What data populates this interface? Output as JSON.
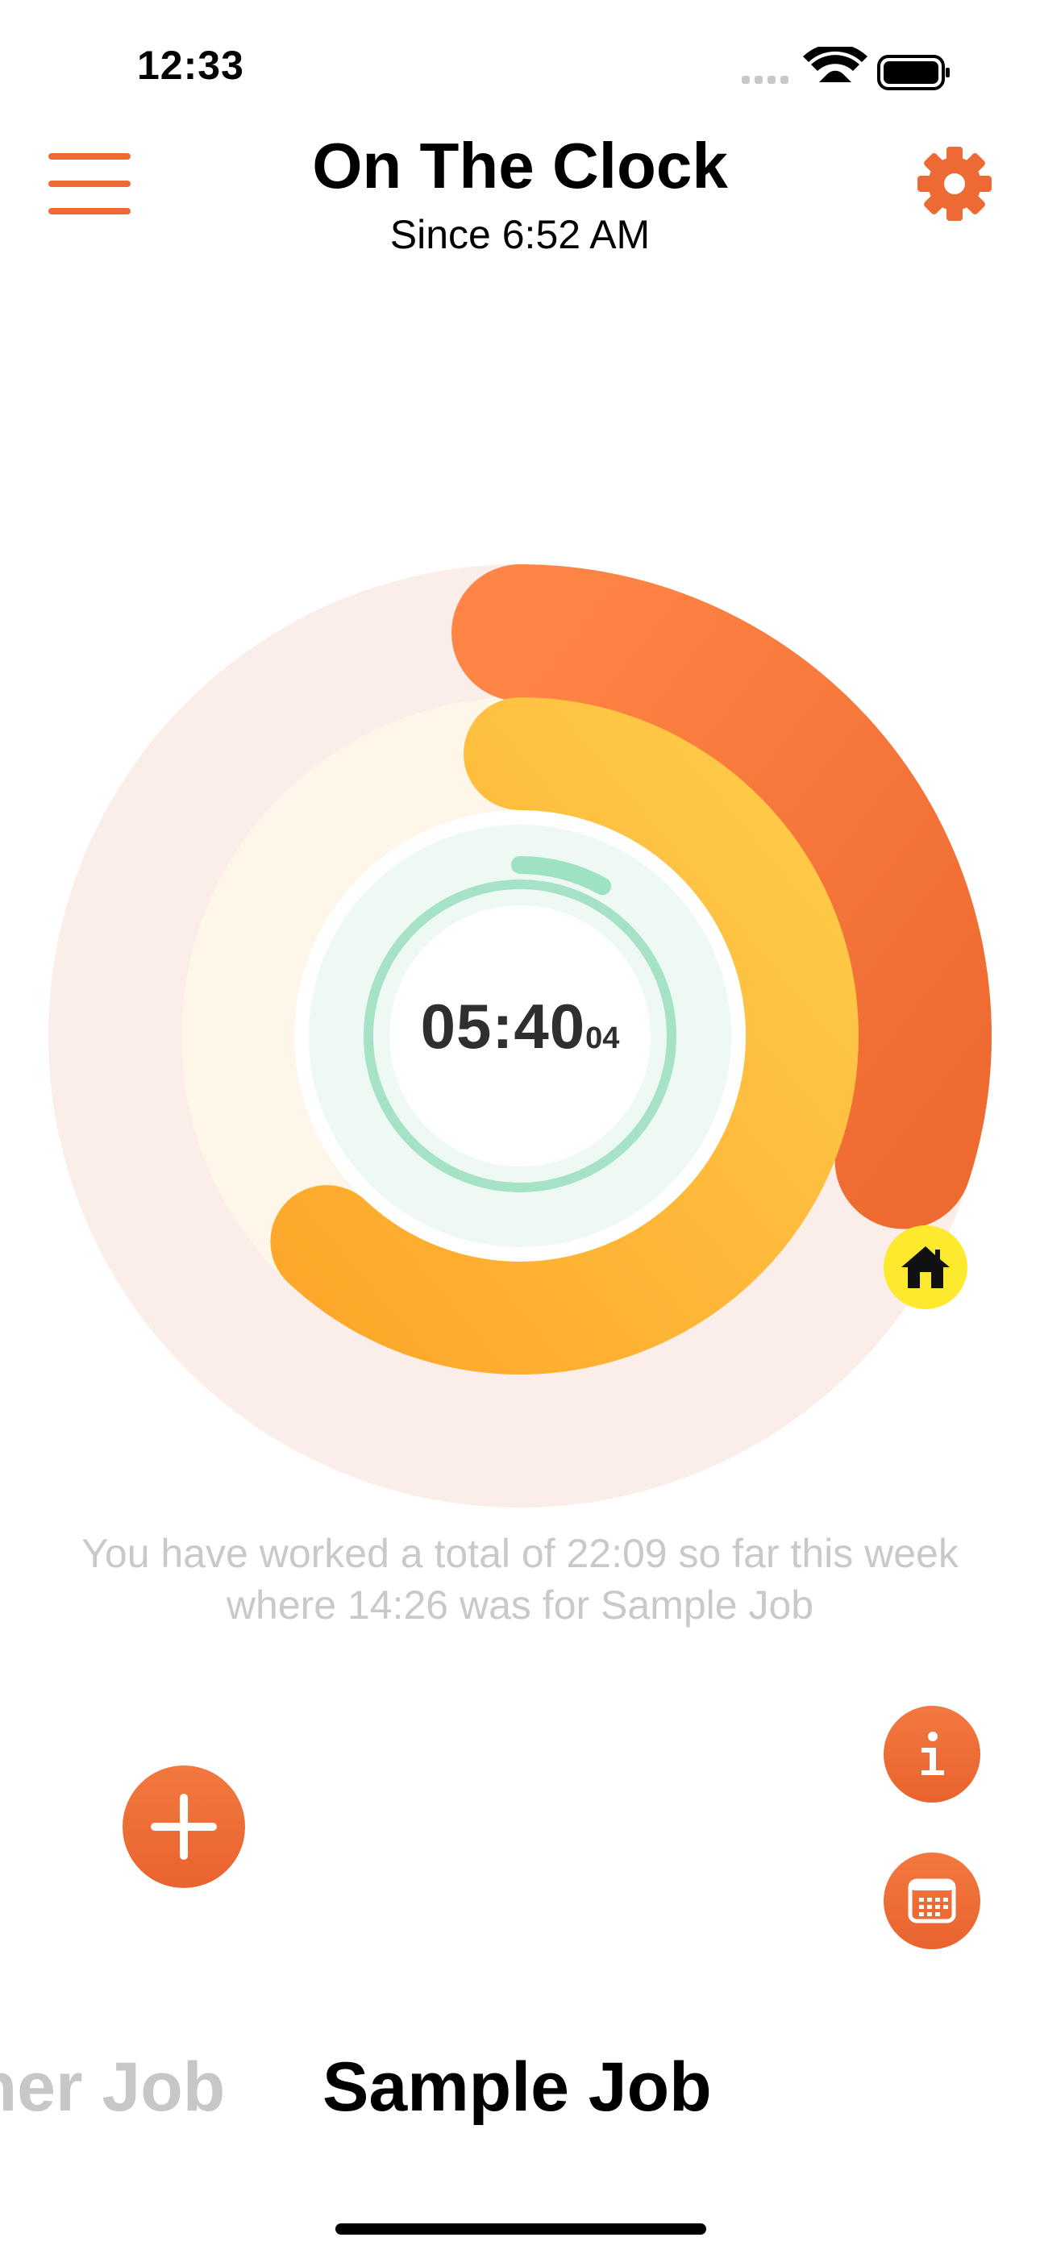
{
  "status_bar": {
    "time": "12:33"
  },
  "header": {
    "title": "On The Clock",
    "subtitle": "Since 6:52 AM"
  },
  "timer": {
    "main": "05:40",
    "seconds": "04"
  },
  "progress": {
    "week_ring_fraction": 0.3,
    "job_ring_fraction": 0.62,
    "day_ring_fraction": 0.08
  },
  "colors": {
    "accent": "#ED6A35",
    "week_ring": "#F47A3C",
    "week_track": "#FBEDE8",
    "job_ring": "#FDBA3A",
    "job_track": "#FFF6EA",
    "day_ring": "#A6E3C6",
    "home_badge": "#FDE92E"
  },
  "summary": {
    "line1": "You have worked a total of 22:09 so far this week",
    "line2": "where 14:26 was for Sample Job"
  },
  "jobs": {
    "previous": "ther Job",
    "current": "Sample Job"
  },
  "icons": {
    "menu": "hamburger-menu-icon",
    "settings": "gear-icon",
    "home": "house-icon",
    "add": "plus-icon",
    "info": "info-icon",
    "calendar": "calendar-icon"
  }
}
